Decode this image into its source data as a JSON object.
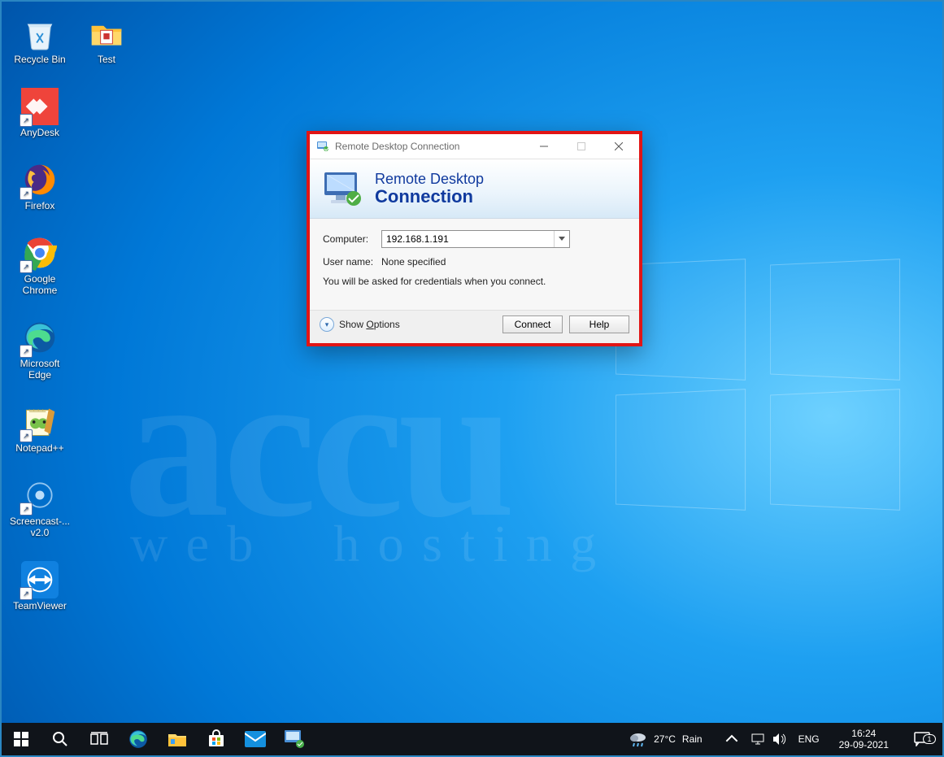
{
  "desktop_icons": [
    {
      "id": "recycle-bin",
      "label": "Recycle Bin"
    },
    {
      "id": "test",
      "label": "Test"
    },
    {
      "id": "anydesk",
      "label": "AnyDesk"
    },
    {
      "id": "firefox",
      "label": "Firefox"
    },
    {
      "id": "google-chrome",
      "label": "Google Chrome"
    },
    {
      "id": "microsoft-edge",
      "label": "Microsoft Edge"
    },
    {
      "id": "notepadpp",
      "label": "Notepad++"
    },
    {
      "id": "screencast",
      "label": "Screencast-... v2.0"
    },
    {
      "id": "teamviewer",
      "label": "TeamViewer"
    }
  ],
  "watermark": {
    "accu": "accu",
    "sub": "web hosting"
  },
  "dialog": {
    "title": "Remote Desktop Connection",
    "banner_line1": "Remote Desktop",
    "banner_line2": "Connection",
    "computer_label": "Computer:",
    "computer_value": "192.168.1.191",
    "username_label": "User name:",
    "username_value": "None specified",
    "hint": "You will be asked for credentials when you connect.",
    "show_options_prefix": "Show ",
    "show_options_u": "O",
    "show_options_suffix": "ptions",
    "connect": "Connect",
    "help": "Help"
  },
  "taskbar": {
    "weather_temp": "27°C",
    "weather_cond": "Rain",
    "lang": "ENG",
    "time": "16:24",
    "date": "29-09-2021",
    "notif_count": "1"
  }
}
